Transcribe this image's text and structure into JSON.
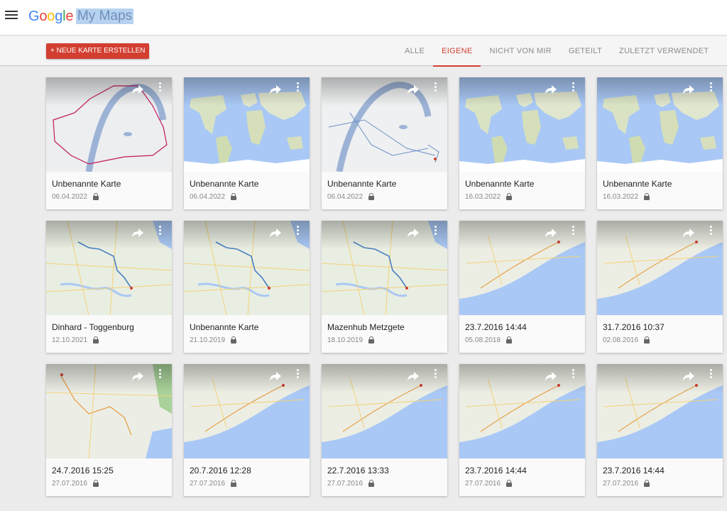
{
  "header": {
    "logo_text": "Google",
    "app_name": "My Maps"
  },
  "toolbar": {
    "create_label": "+ NEUE KARTE ERSTELLEN",
    "tabs": [
      {
        "label": "ALLE",
        "active": false
      },
      {
        "label": "EIGENE",
        "active": true
      },
      {
        "label": "NICHT VON MIR",
        "active": false
      },
      {
        "label": "GETEILT",
        "active": false
      },
      {
        "label": "ZULETZT VERWENDET",
        "active": false
      }
    ]
  },
  "maps": [
    {
      "title": "Unbenannte Karte",
      "date": "06.04.2022",
      "thumb": "city-outline"
    },
    {
      "title": "Unbenannte Karte",
      "date": "06.04.2022",
      "thumb": "world"
    },
    {
      "title": "Unbenannte Karte",
      "date": "06.04.2022",
      "thumb": "city-routes"
    },
    {
      "title": "Unbenannte Karte",
      "date": "16.03.2022",
      "thumb": "world"
    },
    {
      "title": "Unbenannte Karte",
      "date": "16.03.2022",
      "thumb": "world"
    },
    {
      "title": "Dinhard - Toggenburg",
      "date": "12.10.2021",
      "thumb": "region-route"
    },
    {
      "title": "Unbenannte Karte",
      "date": "21.10.2019",
      "thumb": "region-route"
    },
    {
      "title": "Mazenhub Metzgete",
      "date": "18.10.2019",
      "thumb": "region-route"
    },
    {
      "title": "23.7.2016 14:44",
      "date": "05.08.2018",
      "thumb": "coast"
    },
    {
      "title": "31.7.2016 10:37",
      "date": "02.08.2016",
      "thumb": "coast"
    },
    {
      "title": "24.7.2016 15:25",
      "date": "27.07.2016",
      "thumb": "city-road"
    },
    {
      "title": "20.7.2016 12:28",
      "date": "27.07.2016",
      "thumb": "coast"
    },
    {
      "title": "22.7.2016 13:33",
      "date": "27.07.2016",
      "thumb": "coast"
    },
    {
      "title": "23.7.2016 14:44",
      "date": "27.07.2016",
      "thumb": "coast"
    },
    {
      "title": "23.7.2016 14:44",
      "date": "27.07.2016",
      "thumb": "coast"
    }
  ],
  "colors": {
    "accent": "#d23f31",
    "water": "#a9c8f5",
    "land": "#eef0e8",
    "route": "#4a7fc1"
  }
}
